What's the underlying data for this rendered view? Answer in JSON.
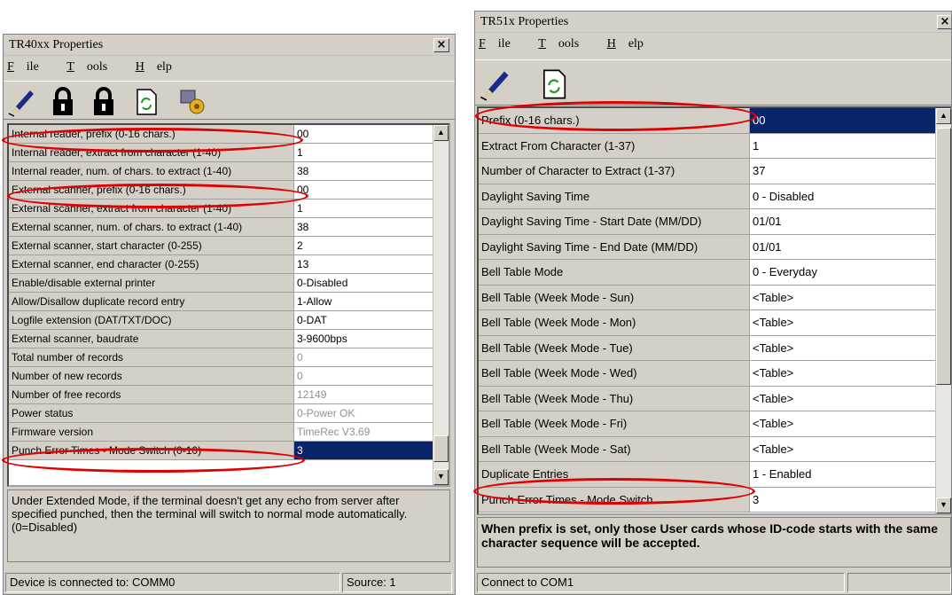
{
  "left_window": {
    "title": "TR40xx Properties",
    "close_glyph": "×",
    "menu": [
      {
        "label_ul": "F",
        "label_rest": "ile"
      },
      {
        "label_ul": "T",
        "label_rest": "ools"
      },
      {
        "label_ul": "H",
        "label_rest": "elp"
      }
    ],
    "toolbar_icons": [
      "pen-icon",
      "lock-icon",
      "lock-icon",
      "refresh-icon",
      "gear-icon"
    ],
    "rows": [
      {
        "key": "Internal reader, prefix (0-16 chars.)",
        "value": "00"
      },
      {
        "key": "Internal reader, extract from character (1-40)",
        "value": "1"
      },
      {
        "key": "Internal reader, num. of chars. to extract (1-40)",
        "value": "38"
      },
      {
        "key": "External scanner, prefix (0-16 chars.)",
        "value": "00"
      },
      {
        "key": "External scanner, extract from character (1-40)",
        "value": "1"
      },
      {
        "key": "External scanner, num. of chars. to extract (1-40)",
        "value": "38"
      },
      {
        "key": "External scanner, start character (0-255)",
        "value": "2"
      },
      {
        "key": "External scanner, end character (0-255)",
        "value": "13"
      },
      {
        "key": "Enable/disable external printer",
        "value": "0-Disabled"
      },
      {
        "key": "Allow/Disallow duplicate record entry",
        "value": "1-Allow"
      },
      {
        "key": "Logfile extension (DAT/TXT/DOC)",
        "value": "0-DAT"
      },
      {
        "key": "External scanner, baudrate",
        "value": "3-9600bps"
      },
      {
        "key": "Total number of records",
        "value": "0",
        "dim": true
      },
      {
        "key": "Number of new records",
        "value": "0",
        "dim": true
      },
      {
        "key": "Number of free records",
        "value": "12149",
        "dim": true
      },
      {
        "key": "Power status",
        "value": "0-Power OK",
        "dim": true
      },
      {
        "key": "Firmware version",
        "value": "TimeRec V3.69",
        "dim": true
      },
      {
        "key": "Punch Error Times - Mode Switch (0-10)",
        "value": "3",
        "selected": true
      }
    ],
    "description": "Under Extended Mode, if the terminal doesn't get any echo from server after specified punched, then the terminal will switch to normal mode automatically. (0=Disabled)",
    "status_left": "Device is connected to: COMM0",
    "status_right": "Source: 1"
  },
  "right_window": {
    "title": "TR51x Properties",
    "close_glyph": "×",
    "menu": [
      {
        "label_ul": "F",
        "label_rest": "ile"
      },
      {
        "label_ul": "T",
        "label_rest": "ools"
      },
      {
        "label_ul": "H",
        "label_rest": "elp"
      }
    ],
    "toolbar_icons": [
      "pen-icon",
      "refresh-icon"
    ],
    "rows": [
      {
        "key": "Prefix (0-16 chars.)",
        "value": "00",
        "selected": true
      },
      {
        "key": "Extract From Character (1-37)",
        "value": "1"
      },
      {
        "key": "Number of Character to Extract (1-37)",
        "value": "37"
      },
      {
        "key": "Daylight Saving Time",
        "value": "0 - Disabled"
      },
      {
        "key": "Daylight Saving Time - Start Date (MM/DD)",
        "value": "01/01"
      },
      {
        "key": "Daylight Saving Time - End Date (MM/DD)",
        "value": "01/01"
      },
      {
        "key": "Bell Table Mode",
        "value": "0 - Everyday"
      },
      {
        "key": "Bell Table (Week Mode - Sun)",
        "value": "<Table>"
      },
      {
        "key": "Bell Table (Week Mode - Mon)",
        "value": "<Table>"
      },
      {
        "key": "Bell Table (Week Mode - Tue)",
        "value": "<Table>"
      },
      {
        "key": "Bell Table (Week Mode - Wed)",
        "value": "<Table>"
      },
      {
        "key": "Bell Table (Week Mode - Thu)",
        "value": "<Table>"
      },
      {
        "key": "Bell Table (Week Mode - Fri)",
        "value": "<Table>"
      },
      {
        "key": "Bell Table (Week Mode - Sat)",
        "value": "<Table>"
      },
      {
        "key": "Duplicate Entries",
        "value": "1 - Enabled"
      },
      {
        "key": "Punch Error Times - Mode Switch",
        "value": "3"
      }
    ],
    "description": "When prefix is set, only those User cards whose ID-code starts with the same character sequence will be accepted.",
    "status_left": "Connect to COM1",
    "status_right": ""
  },
  "colors": {
    "highlight_oval": "#e00000",
    "selection": "#0a246a",
    "window_face": "#d4d0c8"
  }
}
